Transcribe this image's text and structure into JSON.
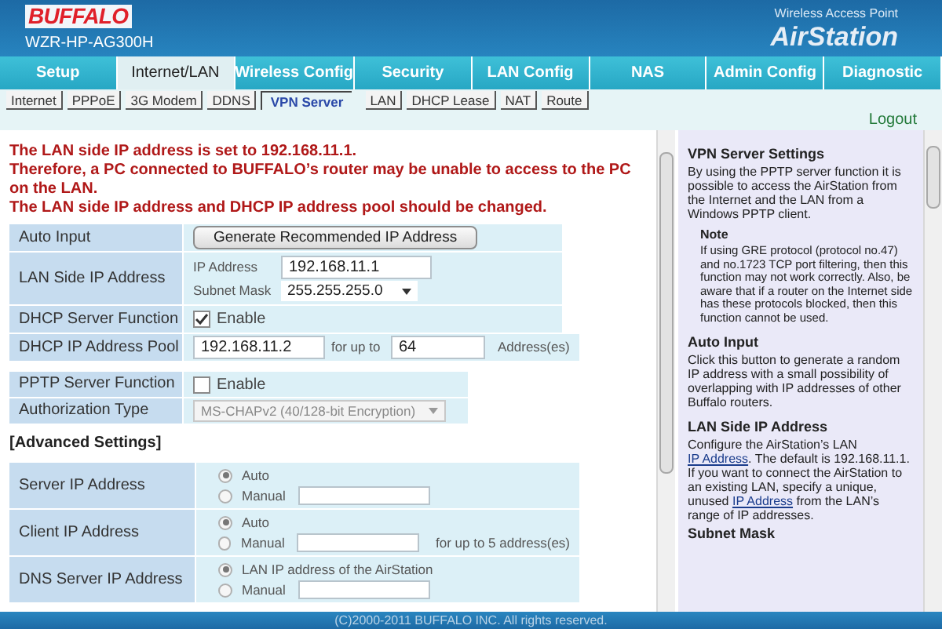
{
  "header": {
    "brand": "BUFFALO",
    "model": "WZR-HP-AG300H",
    "product_line": "Wireless Access Point",
    "product": "AirStation"
  },
  "tabs": [
    {
      "label": "Setup",
      "selected": false
    },
    {
      "label": "Internet/LAN",
      "selected": true
    },
    {
      "label": "Wireless Config",
      "selected": false
    },
    {
      "label": "Security",
      "selected": false
    },
    {
      "label": "LAN Config",
      "selected": false
    },
    {
      "label": "NAS",
      "selected": false
    },
    {
      "label": "Admin Config",
      "selected": false
    },
    {
      "label": "Diagnostic",
      "selected": false
    }
  ],
  "subtabs": [
    {
      "label": "Internet",
      "selected": false
    },
    {
      "label": "PPPoE",
      "selected": false
    },
    {
      "label": "3G Modem",
      "selected": false
    },
    {
      "label": "DDNS",
      "selected": false
    },
    {
      "label": "VPN Server",
      "selected": true
    },
    {
      "label": "LAN",
      "selected": false
    },
    {
      "label": "DHCP Lease",
      "selected": false
    },
    {
      "label": "NAT",
      "selected": false
    },
    {
      "label": "Route",
      "selected": false
    }
  ],
  "logout": "Logout",
  "warning": [
    "The LAN side IP address is set to 192.168.11.1.",
    "Therefore, a PC connected to BUFFALO’s router may be unable to access to the PC on the LAN.",
    "The LAN side IP address and DHCP IP address pool should be changed."
  ],
  "lan_table": [
    {
      "kind": "button",
      "label": "Auto Input",
      "button": "Generate Recommended IP Address"
    },
    {
      "kind": "ip",
      "label": "LAN Side IP Address",
      "ip_label": "IP Address",
      "ip_value": "192.168.11.1",
      "mask_label": "Subnet Mask",
      "mask_value": "255.255.255.0"
    },
    {
      "kind": "checkbox",
      "label": "DHCP Server Function",
      "option": "Enable",
      "checked": true
    },
    {
      "kind": "pool",
      "label": "DHCP IP Address Pool",
      "start": "192.168.11.2",
      "count_label": "for up to",
      "count": "64",
      "suffix": "Address(es)"
    }
  ],
  "pptp_table": [
    {
      "kind": "checkbox",
      "label": "PPTP Server Function",
      "option": "Enable",
      "checked": false
    },
    {
      "kind": "select",
      "label": "Authorization Type",
      "value": "MS-CHAPv2 (40/128-bit Encryption)",
      "disabled": true
    }
  ],
  "advanced_heading": "[Advanced Settings]",
  "advanced_table": [
    {
      "label": "Server IP Address",
      "options": [
        {
          "label": "Auto",
          "kind": "plain",
          "selected": true
        },
        {
          "label": "Manual",
          "kind": "field",
          "selected": false
        }
      ]
    },
    {
      "label": "Client IP Address",
      "options": [
        {
          "label": "Auto",
          "kind": "plain",
          "selected": true
        },
        {
          "label": "Manual",
          "kind": "field",
          "selected": false,
          "suffix": "for up to 5 address(es)"
        }
      ]
    },
    {
      "label": "DNS Server IP Address",
      "options": [
        {
          "label": "LAN IP address of the AirStation",
          "kind": "plain",
          "selected": true
        },
        {
          "label": "Manual",
          "kind": "field",
          "selected": false
        }
      ]
    }
  ],
  "help": [
    {
      "kind": "section",
      "title": "VPN Server Settings",
      "parts": [
        {
          "text": "By using the PPTP server function it is possible to access the AirStation from the Internet and the LAN from a Windows PPTP client.",
          "link": false
        }
      ]
    },
    {
      "kind": "note",
      "title": "Note",
      "parts": [
        {
          "text": "If using GRE protocol (protocol no.47) and no.1723 TCP port filtering, then this function may not work correctly. Also, be aware that if a router on the Internet side has these protocols blocked, then this function cannot be used.",
          "link": false
        }
      ]
    },
    {
      "kind": "section",
      "title": "Auto Input",
      "parts": [
        {
          "text": "Click this button to generate a random IP address with a small possibility of overlapping with IP addresses of other Buffalo routers.",
          "link": false
        }
      ]
    },
    {
      "kind": "section",
      "title": "LAN Side IP Address",
      "parts": [
        {
          "text": "Configure the AirStation’s LAN ",
          "link": false
        },
        {
          "text": "IP Address",
          "link": true
        },
        {
          "text": ". The default is 192.168.11.1. If you want to connect the AirStation to an existing LAN, specify a unique, unused ",
          "link": false
        },
        {
          "text": "IP Address",
          "link": true
        },
        {
          "text": " from the LAN’s range of IP addresses.",
          "link": false
        }
      ]
    },
    {
      "kind": "subheading",
      "title": "Subnet Mask"
    }
  ],
  "footer": "(C)2000-2011 BUFFALO INC. All rights reserved."
}
